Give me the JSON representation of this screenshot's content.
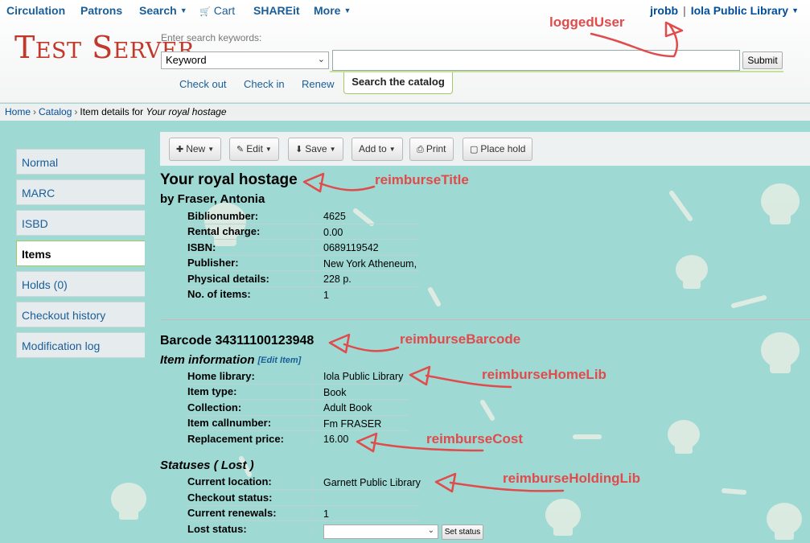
{
  "topnav": {
    "circulation": "Circulation",
    "patrons": "Patrons",
    "search": "Search",
    "cart": "Cart",
    "shareit": "SHAREit",
    "more": "More",
    "user": "jrobb",
    "separator": "|",
    "library": "Iola Public Library"
  },
  "header": {
    "logo": "Test Server",
    "search_hint": "Enter search keywords:",
    "search_type": "Keyword",
    "search_value": "",
    "submit": "Submit",
    "tabs": {
      "checkout": "Check out",
      "checkin": "Check in",
      "renew": "Renew",
      "search_catalog": "Search the catalog"
    }
  },
  "breadcrumb": {
    "home": "Home",
    "sep": "›",
    "catalog": "Catalog",
    "prefix": "Item details for",
    "title": "Your royal hostage"
  },
  "menu": {
    "normal": "Normal",
    "marc": "MARC",
    "isbd": "ISBD",
    "items": "Items",
    "holds": "Holds (0)",
    "checkout_history": "Checkout history",
    "modification_log": "Modification log"
  },
  "toolbar": {
    "new": "New",
    "edit": "Edit",
    "save": "Save",
    "add_to": "Add to",
    "print": "Print",
    "place_hold": "Place hold"
  },
  "record": {
    "title": "Your royal hostage",
    "author": "by Fraser, Antonia",
    "fields": [
      {
        "label": "Biblionumber:",
        "value": "4625"
      },
      {
        "label": "Rental charge:",
        "value": "0.00"
      },
      {
        "label": "ISBN:",
        "value": "0689119542"
      },
      {
        "label": "Publisher:",
        "value": "New York Atheneum,"
      },
      {
        "label": "Physical details:",
        "value": "228 p."
      },
      {
        "label": "No. of items:",
        "value": "1"
      }
    ]
  },
  "item": {
    "barcode_heading": "Barcode 34311100123948",
    "info_heading": "Item information",
    "edit_item": "[Edit Item]",
    "fields": [
      {
        "label": "Home library:",
        "value": "Iola Public Library"
      },
      {
        "label": "Item type:",
        "value": "Book"
      },
      {
        "label": "Collection:",
        "value": "Adult Book"
      },
      {
        "label": "Item callnumber:",
        "value": "Fm FRASER"
      },
      {
        "label": "Replacement price:",
        "value": "16.00"
      }
    ],
    "statuses_heading": "Statuses ( Lost )",
    "status_fields": [
      {
        "label": "Current location:",
        "value": "Garnett Public Library"
      },
      {
        "label": "Checkout status:",
        "value": ""
      },
      {
        "label": "Current renewals:",
        "value": "1"
      },
      {
        "label": "Lost status:",
        "value": ""
      }
    ],
    "lost_status_selected": "",
    "set_status": "Set status"
  },
  "annotations": {
    "logged_user": "loggedUser",
    "title": "reimburseTitle",
    "barcode": "reimburseBarcode",
    "home_lib": "reimburseHomeLib",
    "cost": "reimburseCost",
    "holding_lib": "reimburseHoldingLib",
    "color": "#e04b4b"
  },
  "colors": {
    "link": "#1a5e99",
    "accent_green": "#a2c966",
    "background": "#9fd9d4",
    "logo": "#c0392b"
  }
}
